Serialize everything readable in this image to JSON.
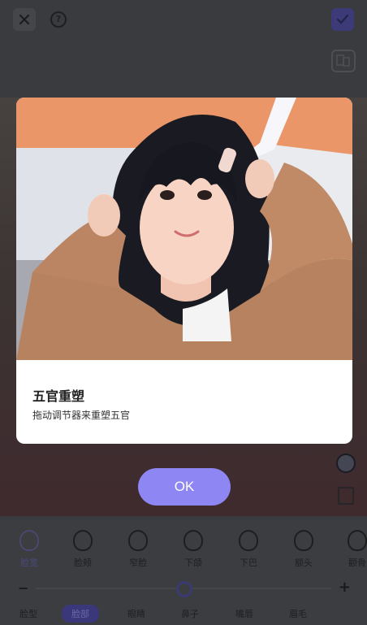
{
  "topbar": {
    "close_icon": "close-icon",
    "help_icon": "help-icon",
    "confirm_icon": "checkmark-icon",
    "compare_icon": "compare-icon"
  },
  "modal": {
    "title": "五官重塑",
    "description": "拖动调节器来重塑五官",
    "ok_label": "OK"
  },
  "features": [
    {
      "label": "脸宽",
      "active": true
    },
    {
      "label": "脸颊",
      "active": false
    },
    {
      "label": "窄脸",
      "active": false
    },
    {
      "label": "下颌",
      "active": false
    },
    {
      "label": "下巴",
      "active": false
    },
    {
      "label": "额头",
      "active": false
    },
    {
      "label": "颧骨",
      "active": false
    }
  ],
  "slider": {
    "minus": "−",
    "plus": "+",
    "value": 0.5
  },
  "categories": [
    {
      "label": "脸型",
      "active": false
    },
    {
      "label": "脸部",
      "active": true
    },
    {
      "label": "眼睛",
      "active": false
    },
    {
      "label": "鼻子",
      "active": false
    },
    {
      "label": "嘴唇",
      "active": false
    },
    {
      "label": "眉毛",
      "active": false
    }
  ],
  "colors": {
    "accent": "#8e86f3",
    "overlay_bg": "#3a3b3e",
    "modal_bg": "#ffffff"
  }
}
